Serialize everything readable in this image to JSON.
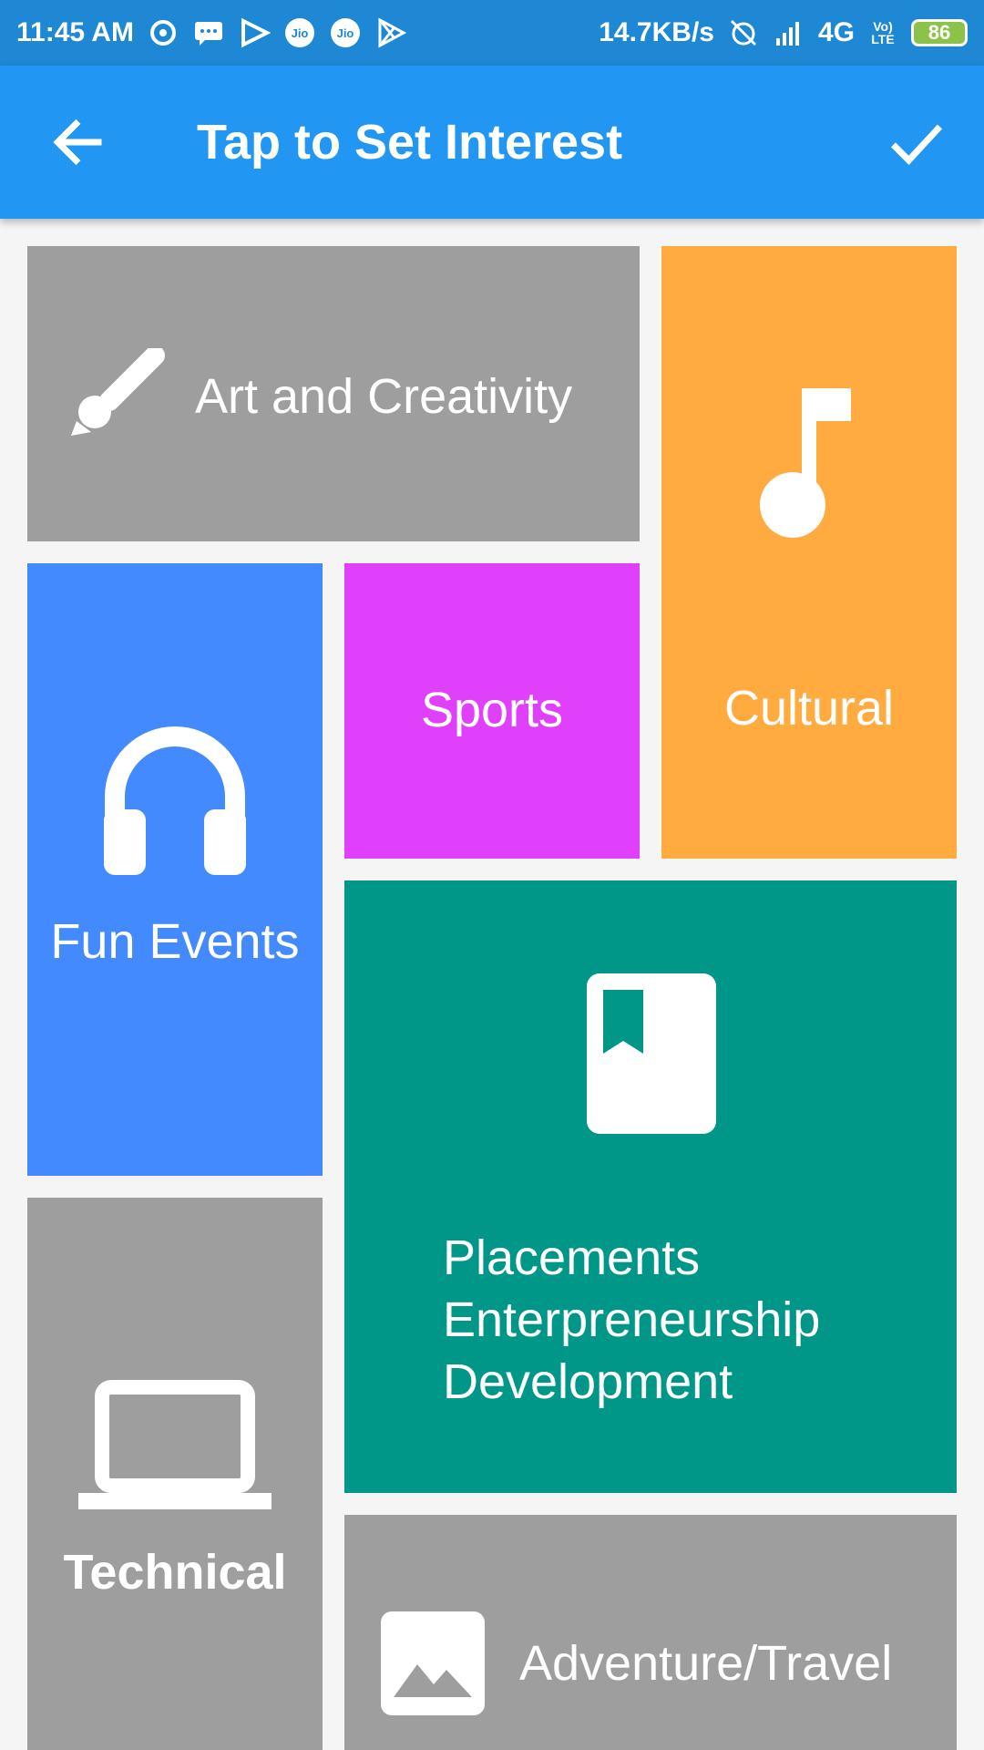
{
  "status_bar": {
    "time": "11:45 AM",
    "network_speed": "14.7KB/s",
    "network_type": "4G",
    "volte": "Vo) LTE",
    "battery": "86",
    "notification_icons": [
      "uc-browser-icon",
      "message-icon",
      "play-icon",
      "jio-icon",
      "jio-icon",
      "play-store-icon"
    ]
  },
  "app_bar": {
    "title": "Tap to Set Interest",
    "back_icon": "arrow-back-icon",
    "confirm_icon": "check-icon"
  },
  "tiles": {
    "art": {
      "label": "Art and Creativity",
      "icon": "brush-icon",
      "color": "#9e9e9e"
    },
    "cultural": {
      "label": "Cultural",
      "icon": "music-note-icon",
      "color": "#ffab40"
    },
    "fun_events": {
      "label": "Fun Events",
      "icon": "headphones-icon",
      "color": "#448aff"
    },
    "sports": {
      "label": "Sports",
      "color": "#e040fb"
    },
    "placements": {
      "lines": [
        "Placements",
        "Enterpreneurship",
        "Development"
      ],
      "icon": "book-icon",
      "color": "#009688"
    },
    "technical": {
      "label": "Technical",
      "icon": "laptop-icon",
      "color": "#9e9e9e"
    },
    "adventure": {
      "label": "Adventure/Travel",
      "icon": "image-icon",
      "color": "#9e9e9e"
    }
  }
}
